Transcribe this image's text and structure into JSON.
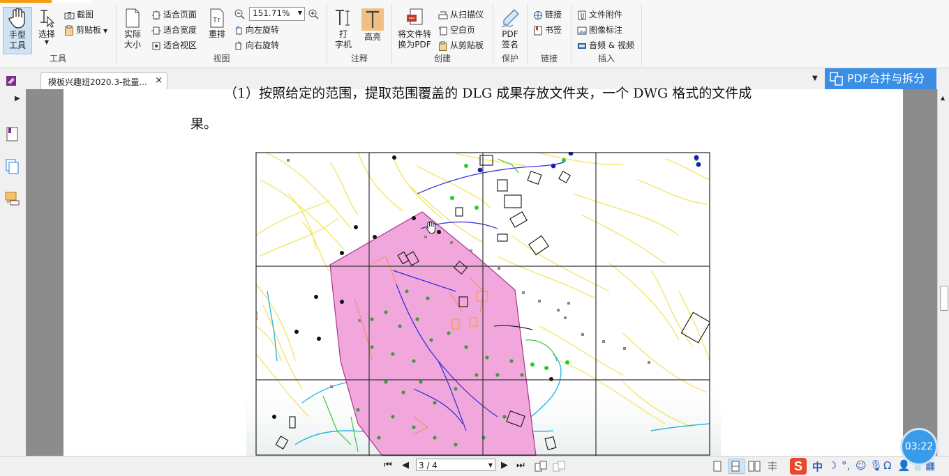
{
  "ribbon": {
    "tools": {
      "hand": "手型\n工具",
      "select": "选择",
      "screenshot": "截图",
      "clipboard": "剪贴板",
      "group": "工具"
    },
    "view": {
      "actual_size": "实际\n大小",
      "fit_page": "适合页面",
      "fit_width": "适合宽度",
      "fit_view": "适合视区",
      "reflow": "重排",
      "zoom": "151.71%",
      "rotate_left": "向左旋转",
      "rotate_right": "向右旋转",
      "group": "视图"
    },
    "comment": {
      "typewriter": "打\n字机",
      "highlight": "高亮",
      "group": "注释"
    },
    "create": {
      "convert": "将文件转\n换为PDF",
      "from_scanner": "从扫描仪",
      "blank_page": "空白页",
      "from_clipboard": "从剪贴板",
      "group": "创建"
    },
    "protect": {
      "sign": "PDF\n签名",
      "group": "保护"
    },
    "links": {
      "link": "链接",
      "bookmark": "书签",
      "group": "链接"
    },
    "insert": {
      "attachment": "文件附件",
      "image_annotation": "图像标注",
      "audio_video": "音频 & 视频",
      "group": "插入"
    }
  },
  "tabs": {
    "doc_title": "模板兴趣班2020.3-批量...",
    "close": "×",
    "merge_button": "PDF合并与拆分"
  },
  "document": {
    "line1": "（1）按照给定的范围，提取范围覆盖的 DLG 成果存放文件夹，一个 DWG 格式的文件成",
    "line2": "果。"
  },
  "status": {
    "page_indicator": "3 / 4",
    "ime_label": "中",
    "timer": "03:22"
  },
  "colors": {
    "accent": "#f39c12",
    "merge": "#3a8ee6",
    "polygon_fill": "#f2a7dc",
    "road": "#f3e66b",
    "water": "#28b7e0"
  }
}
